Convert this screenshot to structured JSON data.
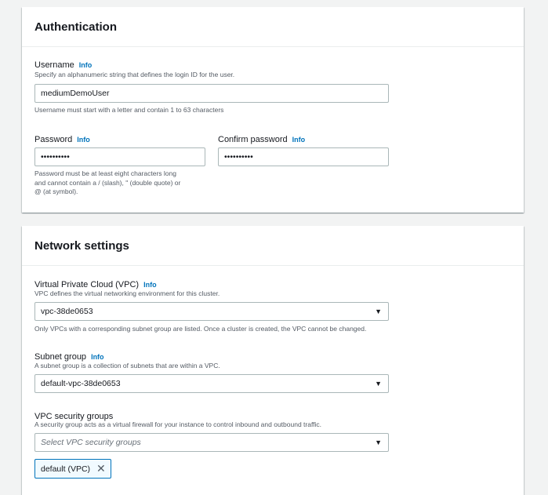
{
  "auth": {
    "title": "Authentication",
    "username": {
      "label": "Username",
      "info": "Info",
      "description": "Specify an alphanumeric string that defines the login ID for the user.",
      "value": "mediumDemoUser",
      "constraint": "Username must start with a letter and contain 1 to 63 characters"
    },
    "password": {
      "label": "Password",
      "info": "Info",
      "value": "••••••••••",
      "constraint_lines": [
        "Password must be at least eight characters long",
        "and cannot contain a / (slash), \" (double quote) or",
        "@ (at symbol)."
      ]
    },
    "confirm_password": {
      "label": "Confirm password",
      "info": "Info",
      "value": "••••••••••"
    }
  },
  "network": {
    "title": "Network settings",
    "vpc": {
      "label": "Virtual Private Cloud (VPC)",
      "info": "Info",
      "description": "VPC defines the virtual networking environment for this cluster.",
      "value": "vpc-38de0653",
      "constraint": "Only VPCs with a corresponding subnet group are listed. Once a cluster is created, the VPC cannot be changed."
    },
    "subnet_group": {
      "label": "Subnet group",
      "info": "Info",
      "description": "A subnet group is a collection of subnets that are within a VPC.",
      "value": "default-vpc-38de0653"
    },
    "security_groups": {
      "label": "VPC security groups",
      "description": "A security group acts as a virtual firewall for your instance to control inbound and outbound traffic.",
      "placeholder": "Select VPC security groups",
      "selected_token": "default (VPC)"
    }
  },
  "icons": {
    "caret": "▼",
    "remove": "✕"
  },
  "colors": {
    "info_link": "#0073bb",
    "background": "#f2f3f3",
    "token_border": "#0073bb"
  }
}
